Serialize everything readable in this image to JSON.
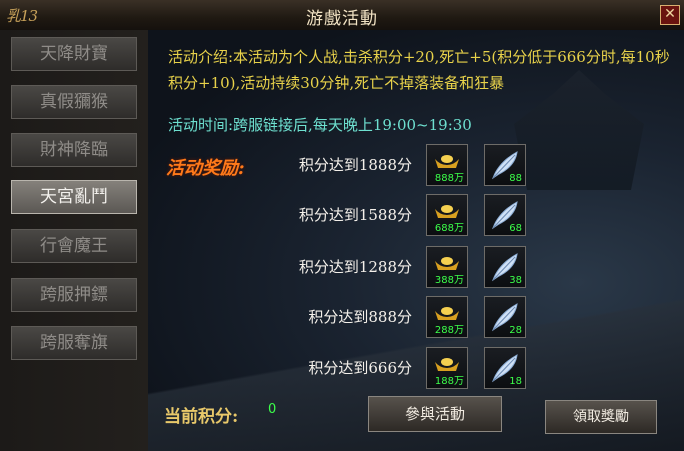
{
  "window": {
    "title": "游戲活動",
    "logo": "乳13",
    "close": "✕"
  },
  "sidebar": {
    "items": [
      {
        "label": "天降財寶",
        "active": false
      },
      {
        "label": "真假獼猴",
        "active": false
      },
      {
        "label": "財神降臨",
        "active": false
      },
      {
        "label": "天宮亂鬥",
        "active": true
      },
      {
        "label": "行會魔王",
        "active": false
      },
      {
        "label": "跨服押鏢",
        "active": false
      },
      {
        "label": "跨服奪旗",
        "active": false
      }
    ]
  },
  "activity": {
    "description": "活动介绍:本活动为个人战,击杀积分+20,死亡+5(积分低于666分时,每10秒积分+10),活动持续30分钟,死亡不掉落装备和狂暴",
    "time": "活动时间:跨服链接后,每天晚上19:00~19:30",
    "reward_label": "活动奖励:",
    "rewards": [
      {
        "condition": "积分达到1888分",
        "gold_count": "888万",
        "feather_count": "88",
        "gold_icon": "gold-ingot-icon",
        "feather_icon": "feather-icon"
      },
      {
        "condition": "积分达到1588分",
        "gold_count": "688万",
        "feather_count": "68",
        "gold_icon": "gold-ingot-icon",
        "feather_icon": "feather-icon"
      },
      {
        "condition": "积分达到1288分",
        "gold_count": "388万",
        "feather_count": "38",
        "gold_icon": "gold-ingot-icon",
        "feather_icon": "feather-icon"
      },
      {
        "condition": "积分达到888分",
        "gold_count": "288万",
        "feather_count": "28",
        "gold_icon": "gold-ingot-icon",
        "feather_icon": "feather-icon"
      },
      {
        "condition": "积分达到666分",
        "gold_count": "188万",
        "feather_count": "18",
        "gold_icon": "gold-ingot-icon",
        "feather_icon": "feather-icon"
      }
    ]
  },
  "score": {
    "label": "当前积分:",
    "value": "0"
  },
  "buttons": {
    "join": "參與活動",
    "claim": "領取獎勵"
  },
  "colors": {
    "description": "#e8d24a",
    "time": "#6ee0d0",
    "reward_label": "#ff7a1a",
    "count": "#3cff4a"
  }
}
